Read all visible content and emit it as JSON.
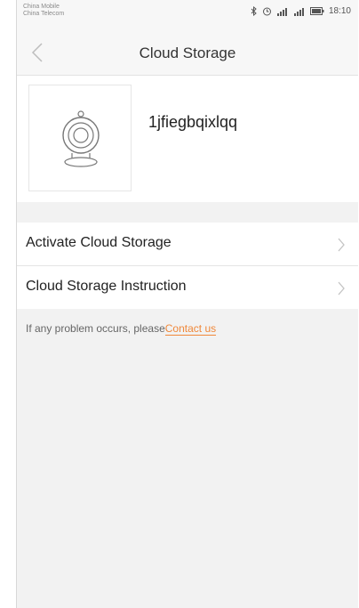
{
  "status_bar": {
    "carrier_1": "China Mobile",
    "carrier_2": "China Telecom",
    "time": "18:10",
    "icons": [
      "bluetooth-icon",
      "alarm-icon",
      "signal-icon",
      "signal-icon",
      "battery-icon"
    ]
  },
  "header": {
    "title": "Cloud Storage",
    "back_icon": "chevron-left-icon"
  },
  "device": {
    "name": "1jfiegbqixlqq",
    "image_icon": "camera-icon"
  },
  "menu": {
    "items": [
      {
        "label": "Activate Cloud Storage",
        "icon": "chevron-right-icon"
      },
      {
        "label": "Cloud Storage Instruction",
        "icon": "chevron-right-icon"
      }
    ]
  },
  "help": {
    "text": "If any problem occurs, please",
    "link": "Contact us"
  },
  "colors": {
    "accent": "#f0883a",
    "background": "#f2f2f2"
  }
}
